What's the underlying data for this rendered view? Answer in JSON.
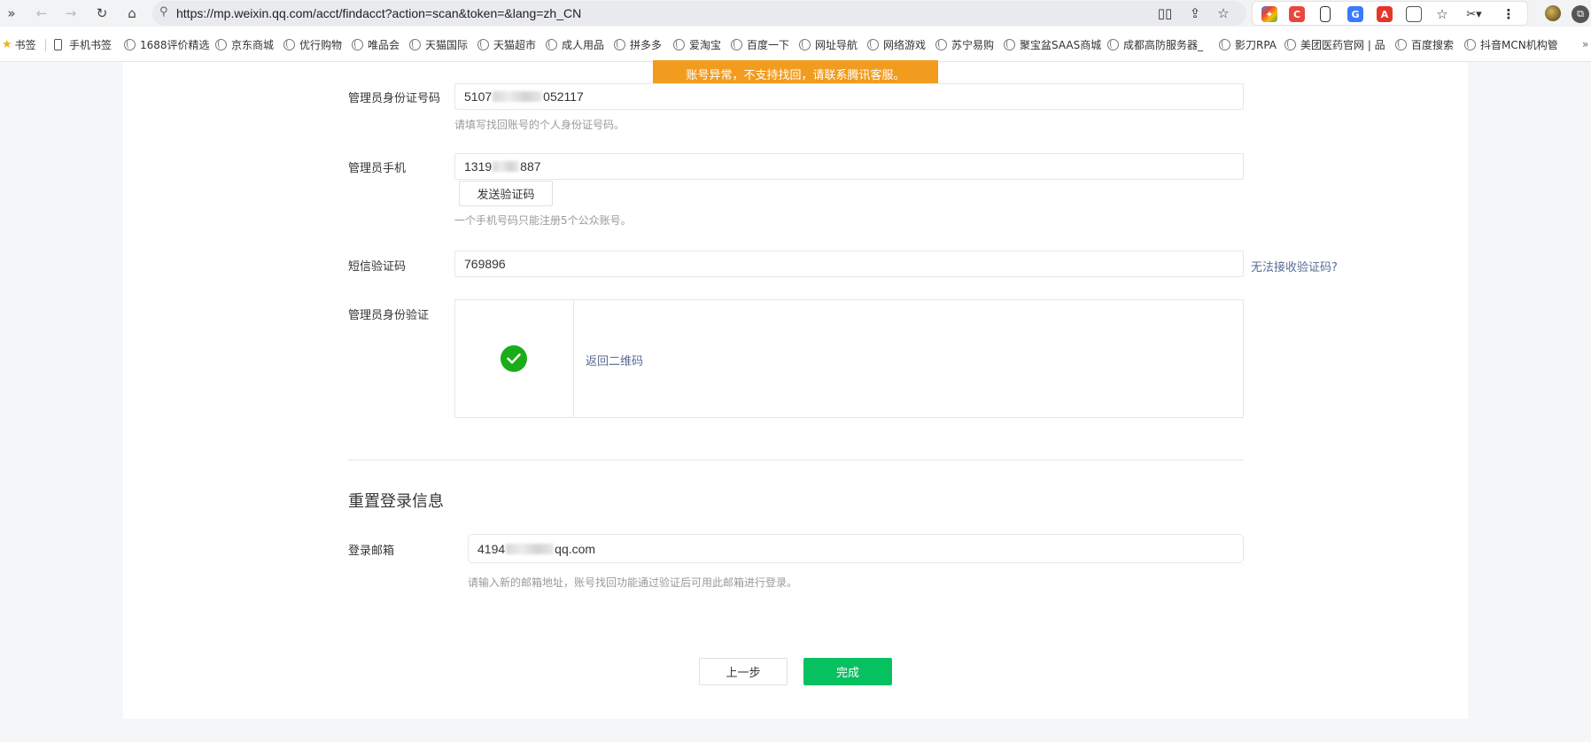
{
  "browser": {
    "url": "https://mp.weixin.qq.com/acct/findacct?action=scan&token=&lang=zh_CN",
    "bookmarks": [
      "书签",
      "手机书签",
      "1688评价精选",
      "京东商城",
      "优行购物",
      "唯品会",
      "天猫国际",
      "天猫超市",
      "成人用品",
      "拼多多",
      "爱淘宝",
      "百度一下",
      "网址导航",
      "网络游戏",
      "苏宁易购",
      "聚宝盆SAAS商城",
      "成都高防服务器_",
      "影刀RPA",
      "美团医药官网 | 品",
      "百度搜索",
      "抖音MCN机构管"
    ]
  },
  "banner": "账号异常，不支持找回，请联系腾讯客服。",
  "form": {
    "id_label": "管理员身份证号码",
    "id_prefix": "5107",
    "id_suffix": "052117",
    "id_hint": "请填写找回账号的个人身份证号码。",
    "phone_label": "管理员手机",
    "phone_prefix": "1319",
    "phone_suffix": "887",
    "send_code_button": "发送验证码",
    "phone_hint": "一个手机号码只能注册5个公众账号。",
    "sms_label": "短信验证码",
    "sms_value": "769896",
    "no_code_link": "无法接收验证码?",
    "verify_label": "管理员身份验证",
    "back_qr_link": "返回二维码"
  },
  "reset": {
    "title": "重置登录信息",
    "email_label": "登录邮箱",
    "email_prefix": "4194",
    "email_suffix": "qq.com",
    "email_hint": "请输入新的邮箱地址，账号找回功能通过验证后可用此邮箱进行登录。"
  },
  "actions": {
    "prev_button": "上一步",
    "done_button": "完成"
  },
  "colors": {
    "banner": "#f29c1f",
    "primary": "#07c160",
    "link": "#576b95",
    "check": "#1aad19"
  }
}
